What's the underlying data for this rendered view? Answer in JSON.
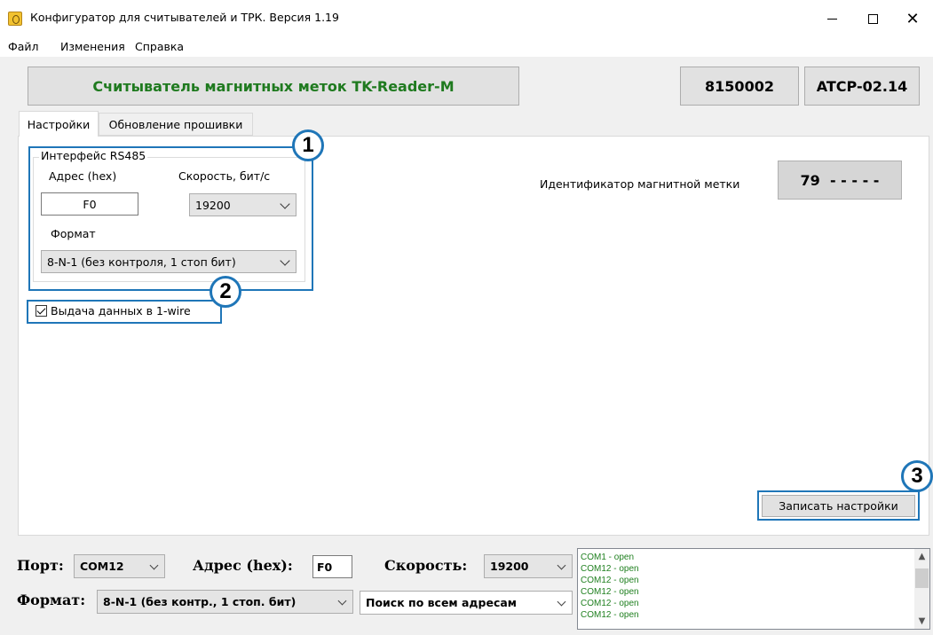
{
  "window": {
    "title": "Конфигуратор для считывателей и ТРК. Версия 1.19",
    "minimize_symbol": "",
    "close_symbol": "✕"
  },
  "menu": [
    "Файл",
    "Изменения",
    "Справка"
  ],
  "header": {
    "device_name": "Считыватель магнитных меток TK-Reader-M",
    "serial": "8150002",
    "firmware": "ATCP-02.14"
  },
  "tabs": [
    "Настройки",
    "Обновление прошивки"
  ],
  "rs485": {
    "legend": "Интерфейс RS485",
    "address_label": "Адрес (hex)",
    "address_value": "F0",
    "speed_label": "Скорость, бит/с",
    "speed_value": "19200",
    "format_label": "Формат",
    "format_value": "8-N-1 (без контроля, 1 стоп бит)"
  },
  "onewire": {
    "label": "Выдача данных в 1-wire",
    "checked": true
  },
  "magnetic": {
    "label": "Идентификатор магнитной метки",
    "value": "79  - - - - -"
  },
  "save_button": "Записать настройки",
  "callouts": [
    "1",
    "2",
    "3"
  ],
  "callout_color": "#1f76b8",
  "bottom": {
    "port_label": "Порт:",
    "port_value": "COM12",
    "address_label": "Адрес (hex):",
    "address_value": "F0",
    "speed_label": "Скорость:",
    "speed_value": "19200",
    "format_label": "Формат:",
    "format_value": "8-N-1 (без контр., 1 стоп. бит)",
    "search_value": "Поиск по всем адресам"
  },
  "log": [
    "COM1 - open",
    "COM12 - open",
    "COM12 - open",
    "COM12 - open",
    "COM12 - open",
    "COM12 - open"
  ],
  "colors": {
    "device_name": "#1f7a1f",
    "log_text": "#208020"
  }
}
